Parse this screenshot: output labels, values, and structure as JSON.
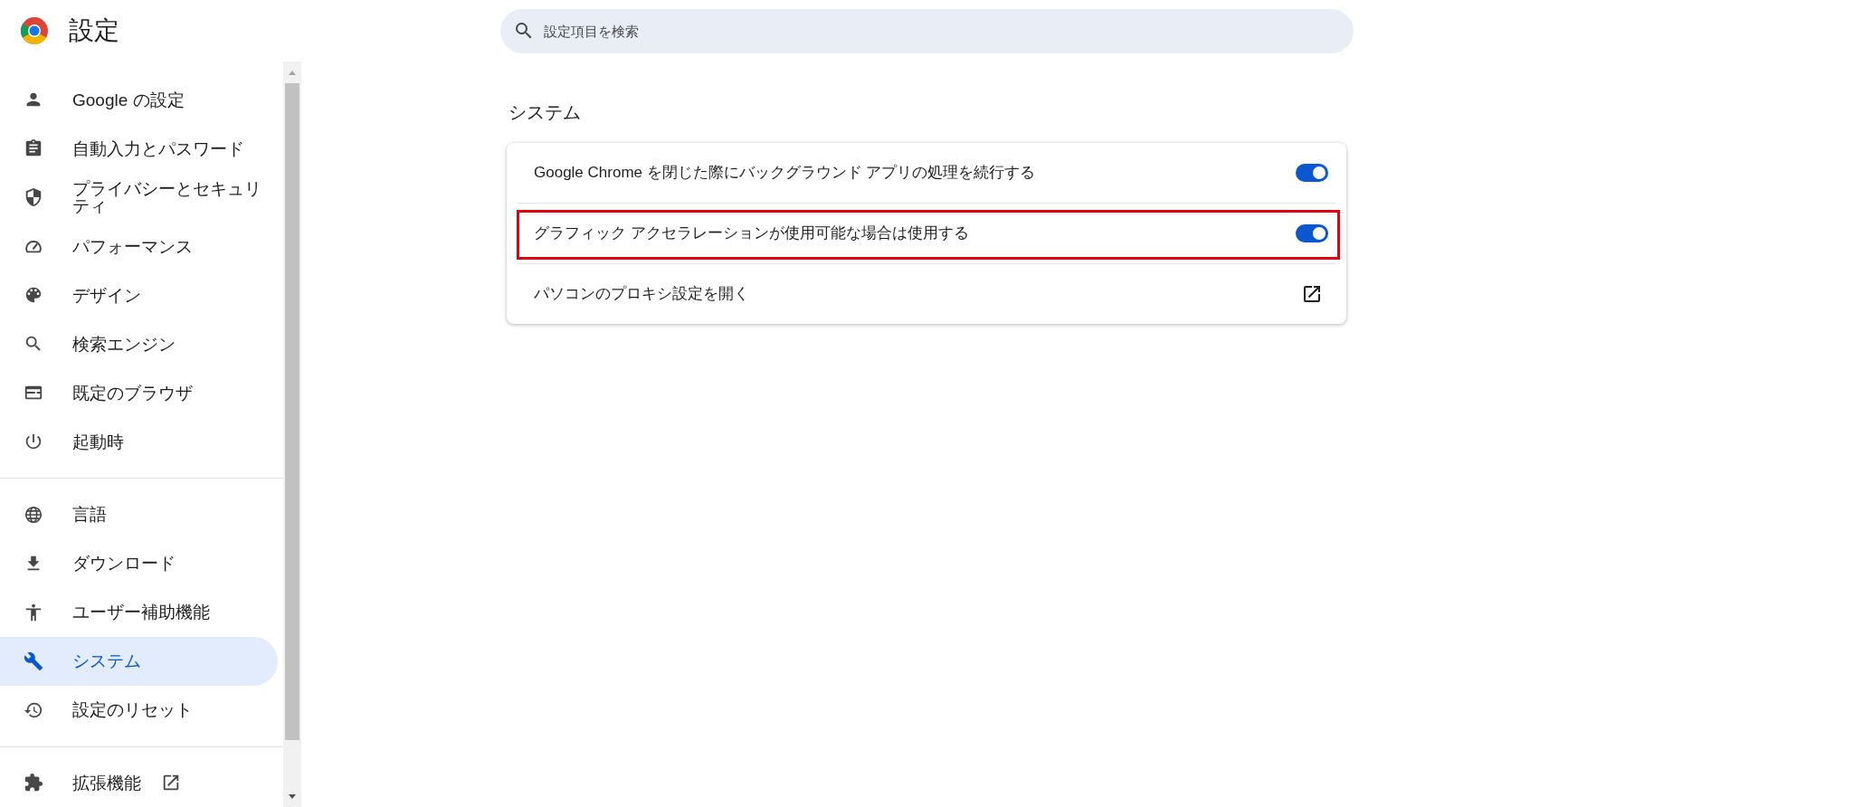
{
  "header": {
    "title": "設定"
  },
  "search": {
    "placeholder": "設定項目を検索"
  },
  "sidebar": {
    "sections": [
      {
        "items": [
          {
            "label": "Google の設定",
            "kind": "page",
            "selected": false
          },
          {
            "label": "自動入力とパスワード",
            "kind": "page",
            "selected": false
          },
          {
            "label": "プライバシーとセキュリティ",
            "kind": "page",
            "selected": false
          },
          {
            "label": "パフォーマンス",
            "kind": "page",
            "selected": false
          },
          {
            "label": "デザイン",
            "kind": "page",
            "selected": false
          },
          {
            "label": "検索エンジン",
            "kind": "page",
            "selected": false
          },
          {
            "label": "既定のブラウザ",
            "kind": "page",
            "selected": false
          },
          {
            "label": "起動時",
            "kind": "page",
            "selected": false
          }
        ]
      },
      {
        "items": [
          {
            "label": "言語",
            "kind": "page",
            "selected": false
          },
          {
            "label": "ダウンロード",
            "kind": "page",
            "selected": false
          },
          {
            "label": "ユーザー補助機能",
            "kind": "page",
            "selected": false
          },
          {
            "label": "システム",
            "kind": "page",
            "selected": true
          },
          {
            "label": "設定のリセット",
            "kind": "page",
            "selected": false
          }
        ]
      },
      {
        "items": [
          {
            "label": "拡張機能",
            "kind": "external",
            "selected": false
          }
        ]
      }
    ]
  },
  "section": {
    "title": "システム",
    "settings": [
      {
        "label": "Google Chrome を閉じた際にバックグラウンド アプリの処理を続行する",
        "kind": "toggle",
        "on": true,
        "highlighted": false
      },
      {
        "label": "グラフィック アクセラレーションが使用可能な場合は使用する",
        "kind": "toggle",
        "on": true,
        "highlighted": true
      },
      {
        "label": "パソコンのプロキシ設定を開く",
        "kind": "link",
        "highlighted": false
      }
    ]
  }
}
